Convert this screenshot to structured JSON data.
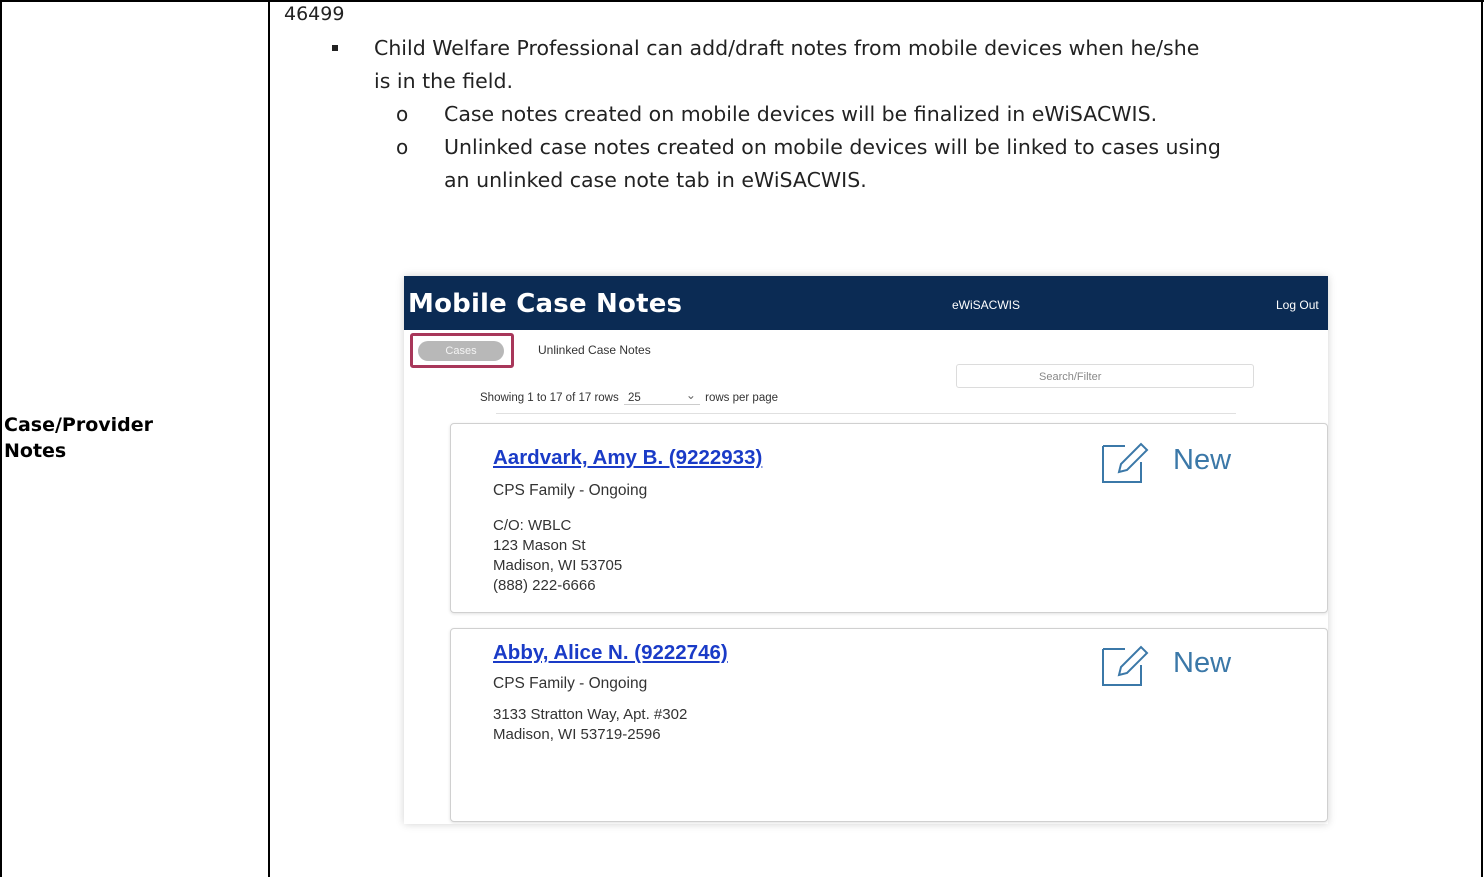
{
  "requirement": {
    "id": "46499",
    "section_label_line1": "Case/Provider",
    "section_label_line2": "Notes",
    "bullet_1": "Child Welfare Professional can add/draft notes from mobile devices when he/she",
    "bullet_1_cont": "is in the field.",
    "sub_1": "Case notes created on mobile devices will be finalized in eWiSACWIS.",
    "sub_2_line1": "Unlinked case notes created on mobile devices will be linked to cases using",
    "sub_2_line2": "an unlinked case note tab in eWiSACWIS."
  },
  "mobile": {
    "title": "Mobile Case Notes",
    "brand": "eWiSACWIS",
    "logout": "Log Out",
    "tabs": {
      "cases": "Cases",
      "unlinked": "Unlinked Case Notes"
    },
    "search_placeholder": "Search/Filter",
    "pagination": {
      "showing": "Showing 1 to 17 of 17 rows",
      "per_page_value": "25",
      "per_page_label": "rows per page"
    },
    "cases": [
      {
        "name": "Aardvark, Amy B. (9222933)",
        "type": "CPS Family - Ongoing",
        "address": [
          "C/O: WBLC",
          "123 Mason St",
          "Madison, WI 53705",
          "(888) 222-6666"
        ],
        "new_label": "New"
      },
      {
        "name": "Abby, Alice N. (9222746)",
        "type": "CPS Family - Ongoing",
        "address": [
          "3133 Stratton Way, Apt. #302",
          "Madison, WI 53719-2596"
        ],
        "new_label": "New"
      }
    ]
  },
  "colors": {
    "header_bg": "#0b2b54",
    "link": "#1a3bc7",
    "highlight_border": "#a8375a",
    "new_icon": "#3b78a8"
  },
  "icons": {
    "new": "edit-note-icon",
    "dropdown": "chevron-down-icon"
  }
}
